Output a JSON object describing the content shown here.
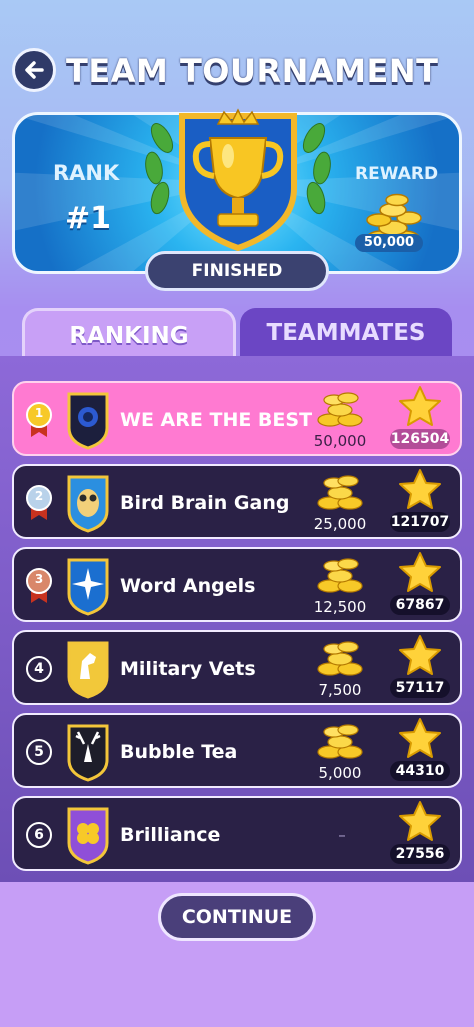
{
  "header": {
    "title": "TEAM TOURNAMENT",
    "back_icon": "arrow-left-icon"
  },
  "banner": {
    "rank_label": "RANK",
    "rank_value": "#1",
    "reward_label": "REWARD",
    "reward_value": "50,000",
    "status": "FINISHED"
  },
  "tabs": {
    "ranking": "RANKING",
    "teammates": "TEAMMATES",
    "active": "ranking"
  },
  "rows": [
    {
      "position": "1",
      "name": "WE ARE THE BEST",
      "reward": "50,000",
      "score": "126504",
      "highlight": true,
      "shield_color": "#1c1f3d",
      "emblem": "lion-icon"
    },
    {
      "position": "2",
      "name": "Bird Brain Gang",
      "reward": "25,000",
      "score": "121707",
      "highlight": false,
      "shield_color": "#2b8fe0",
      "emblem": "owl-icon"
    },
    {
      "position": "3",
      "name": "Word Angels",
      "reward": "12,500",
      "score": "67867",
      "highlight": false,
      "shield_color": "#1b6fd0",
      "emblem": "starburst-icon"
    },
    {
      "position": "4",
      "name": "Military Vets",
      "reward": "7,500",
      "score": "57117",
      "highlight": false,
      "shield_color": "#f2c83a",
      "emblem": "horse-icon"
    },
    {
      "position": "5",
      "name": "Bubble Tea",
      "reward": "5,000",
      "score": "44310",
      "highlight": false,
      "shield_color": "#1d1d2a",
      "emblem": "deer-icon"
    },
    {
      "position": "6",
      "name": "Brilliance",
      "reward": "–",
      "score": "27556",
      "highlight": false,
      "shield_color": "#8f4fd8",
      "emblem": "clover-icon"
    }
  ],
  "continue_label": "CONTINUE",
  "colors": {
    "highlight": "#ff7ad1",
    "row_bg": "#2a2146",
    "gold": "#f5c22b",
    "panel": "#7a58c6"
  }
}
